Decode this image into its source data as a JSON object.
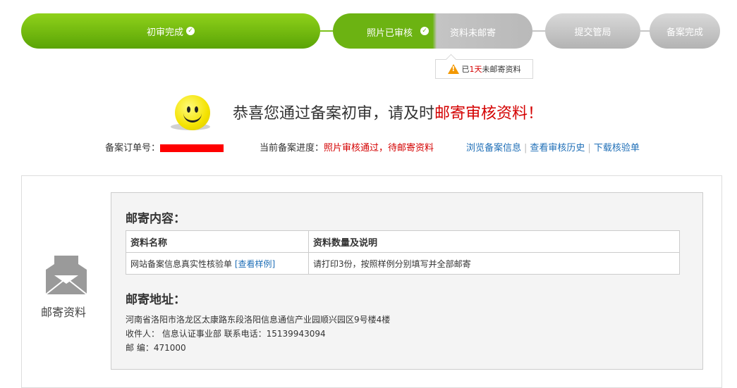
{
  "steps": {
    "s1": "初审完成",
    "s2": "照片已审核",
    "s3": "资料未邮寄",
    "s4": "提交管局",
    "s5": "备案完成"
  },
  "notice": {
    "prefix": "已",
    "days": "1天",
    "suffix": "未邮寄资料"
  },
  "congrats": {
    "main": "恭喜您通过备案初审，请及时",
    "highlight": "邮寄审核资料！"
  },
  "order": {
    "label": "备案订单号："
  },
  "progress": {
    "label": "当前备案进度：",
    "value": "照片审核通过，待邮寄资料"
  },
  "links": {
    "view": "浏览备案信息",
    "history": "查看审核历史",
    "download": "下载核验单"
  },
  "sidebar": {
    "label": "邮寄资料"
  },
  "mail_content": {
    "title": "邮寄内容：",
    "headers": [
      "资料名称",
      "资料数量及说明"
    ],
    "row": {
      "name": "网站备案信息真实性核验单",
      "example": "[查看样例]",
      "desc": "请打印3份，按照样例分别填写并全部邮寄"
    }
  },
  "mail_address": {
    "title": "邮寄地址：",
    "address": "河南省洛阳市洛龙区太康路东段洛阳信息通信产业园顺兴园区9号楼4楼",
    "recipient": "收件人： 信息认证事业部 联系电话：15139943094",
    "postcode": "邮 编：471000"
  },
  "colors": {
    "accent_green": "#6cb312",
    "red": "#d40000",
    "link_blue": "#1f6fb7",
    "warning": "#f39800"
  }
}
